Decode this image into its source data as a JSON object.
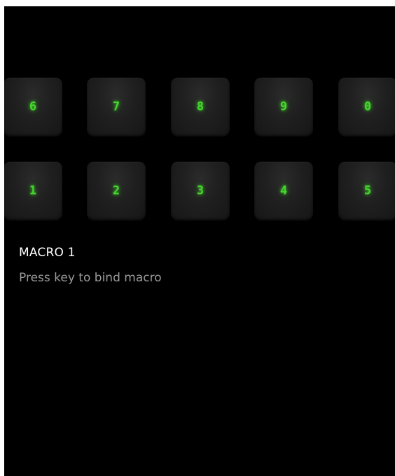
{
  "keypad": {
    "top_row": [
      "6",
      "7",
      "8",
      "9",
      "0"
    ],
    "bottom_row": [
      "1",
      "2",
      "3",
      "4",
      "5"
    ],
    "glyph_color": "#44d62c",
    "panel_background": "#000000"
  },
  "macro": {
    "title": "MACRO 1",
    "hint": "Press key to bind macro"
  }
}
